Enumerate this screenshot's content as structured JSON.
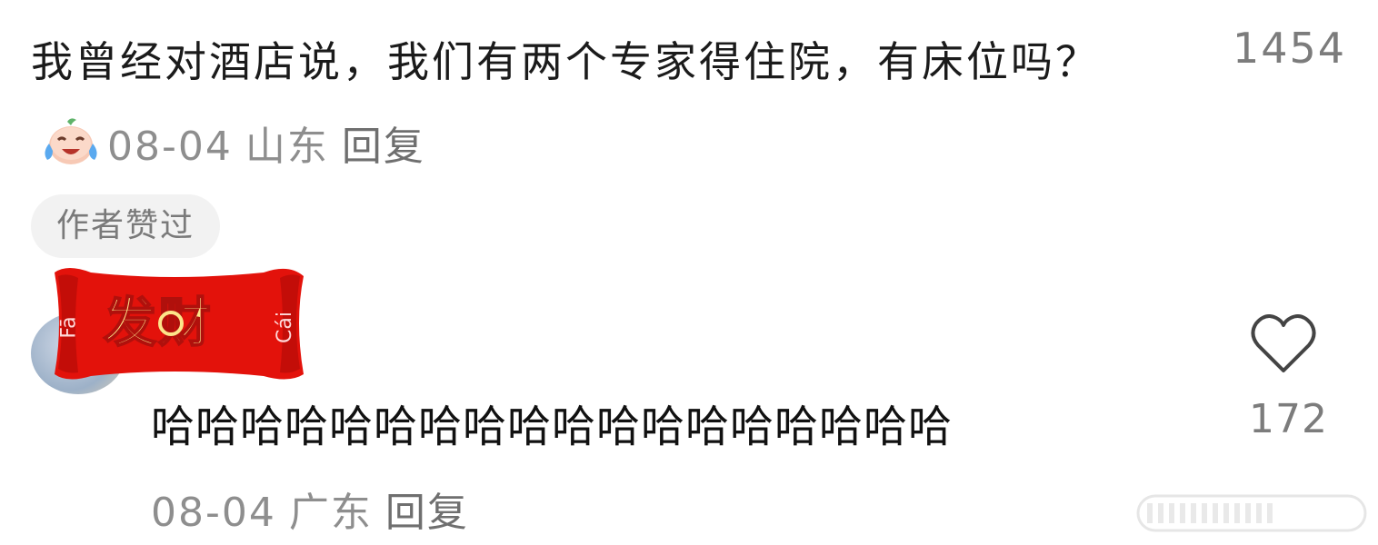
{
  "comment1": {
    "text": "我曾经对酒店说，我们有两个专家得住院，有床位吗？",
    "emoji": "crying-laughing-emoji",
    "date": "08-04",
    "location": "山东",
    "reply_label": "回复",
    "like_count": "1454",
    "badge": "作者赞过"
  },
  "comment2": {
    "banner": {
      "text": "发财",
      "pinyin_left": "Fā",
      "pinyin_right": "Cái"
    },
    "text": "哈哈哈哈哈哈哈哈哈哈哈哈哈哈哈哈哈哈",
    "date": "08-04",
    "location": "广东",
    "reply_label": "回复",
    "like_count": "172",
    "like_icon": "heart-icon"
  },
  "colors": {
    "banner_red": "#e3120b",
    "banner_gold": "#fde58a",
    "meta_gray": "#8e8e8e"
  }
}
